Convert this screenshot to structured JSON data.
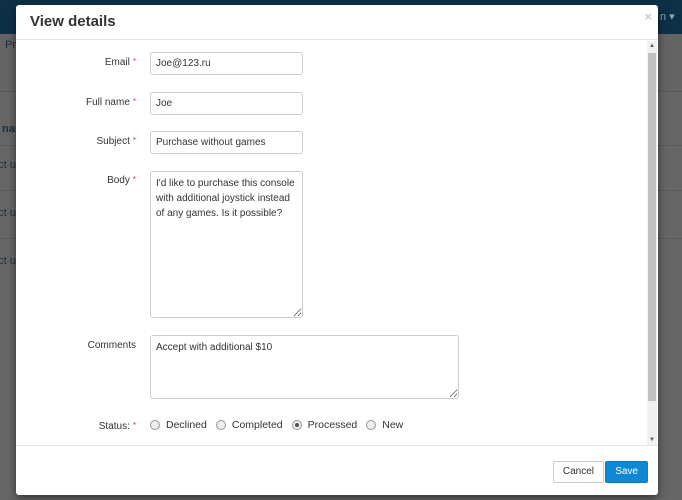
{
  "background": {
    "nav_fragment": "Pr",
    "user_fragment": "n ▾",
    "column_fragment": "nam",
    "row_fragments": [
      "act u",
      "act u",
      "act u"
    ]
  },
  "modal": {
    "title": "View details",
    "close_icon": "×"
  },
  "form": {
    "email": {
      "label": "Email",
      "value": "Joe@123.ru"
    },
    "full_name": {
      "label": "Full name",
      "value": "Joe"
    },
    "subject": {
      "label": "Subject",
      "value": "Purchase without games"
    },
    "body": {
      "label": "Body",
      "value": "I'd like to purchase this console with additional joystick instead of any games. Is it possible?"
    },
    "comments": {
      "label": "Comments",
      "value": "Accept with additional $10"
    },
    "status": {
      "label": "Status:",
      "options": [
        "Declined",
        "Completed",
        "Processed",
        "New"
      ],
      "selected": "Processed"
    },
    "required_marker": "*"
  },
  "footer": {
    "cancel_label": "Cancel",
    "save_label": "Save"
  },
  "colors": {
    "primary": "#0e88d3",
    "required": "#e33333"
  }
}
